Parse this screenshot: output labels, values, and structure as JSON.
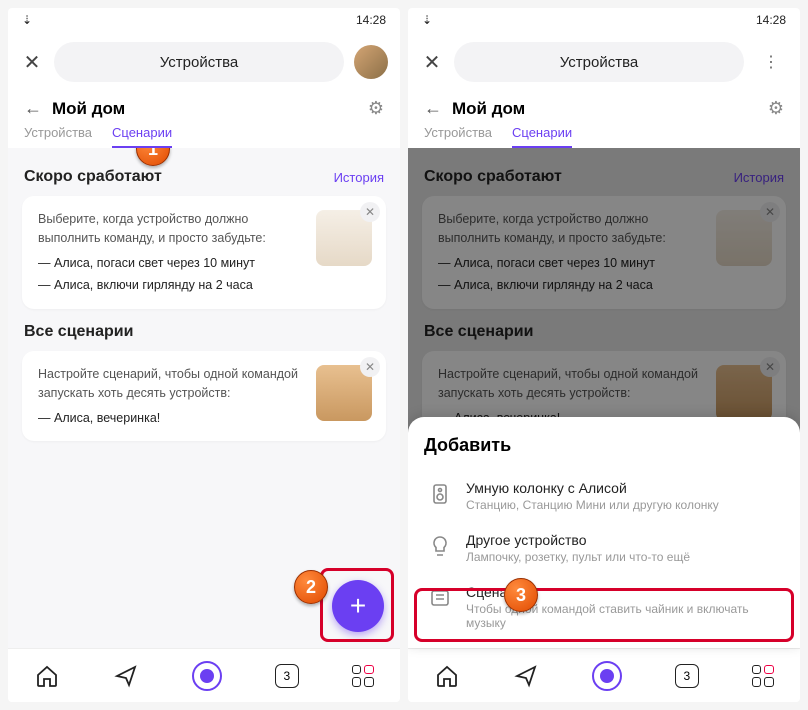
{
  "status": {
    "time": "14:28"
  },
  "topbar": {
    "title": "Устройства"
  },
  "subheader": {
    "home": "Мой дом"
  },
  "tabs": {
    "devices": "Устройства",
    "scenarios": "Сценарии"
  },
  "soon": {
    "title": "Скоро сработают",
    "history": "История",
    "card": {
      "lead": "Выберите, когда устройство должно выполнить команду, и просто забудьте:",
      "cmd1": "Алиса, погаси свет через 10 минут",
      "cmd2": "Алиса, включи гирлянду на 2 часа"
    }
  },
  "all": {
    "title": "Все сценарии",
    "card": {
      "lead": "Настройте сценарий, чтобы одной командой запускать хоть десять устройств:",
      "cmd1": "Алиса, вечеринка!"
    }
  },
  "nav": {
    "counter": "3"
  },
  "sheet": {
    "title": "Добавить",
    "items": [
      {
        "title": "Умную колонку с Алисой",
        "sub": "Станцию, Станцию Мини или другую колонку"
      },
      {
        "title": "Другое устройство",
        "sub": "Лампочку, розетку, пульт или что-то ещё"
      },
      {
        "title": "Сценарий",
        "sub": "Чтобы одной командой ставить чайник и включать музыку"
      }
    ]
  },
  "callouts": {
    "c1": "1",
    "c2": "2",
    "c3": "3"
  }
}
